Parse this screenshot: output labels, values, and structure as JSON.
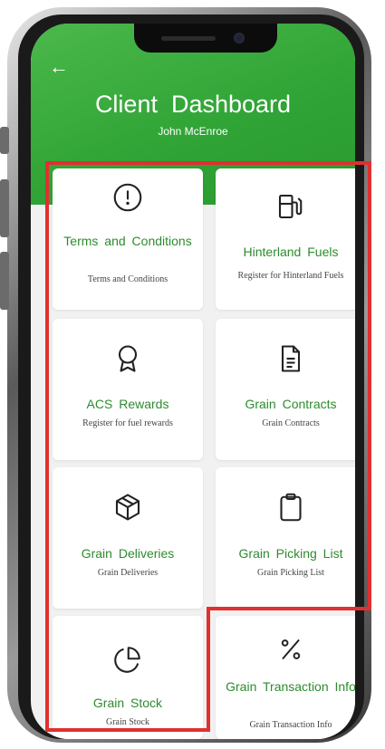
{
  "header": {
    "title": "Client  Dashboard",
    "user_name": "John McEnroe"
  },
  "cards": [
    {
      "label": "Terms  and Conditions",
      "desc": "Terms and Conditions",
      "icon": "alert-circle-icon"
    },
    {
      "label": "Hinterland  Fuels",
      "desc": "Register for Hinterland Fuels",
      "icon": "fuel-pump-icon"
    },
    {
      "label": "ACS  Rewards",
      "desc": "Register for fuel rewards",
      "icon": "award-icon"
    },
    {
      "label": "Grain  Contracts",
      "desc": "Grain Contracts",
      "icon": "document-icon"
    },
    {
      "label": "Grain  Deliveries",
      "desc": "Grain Deliveries",
      "icon": "box-icon"
    },
    {
      "label": "Grain  Picking  List",
      "desc": "Grain Picking List",
      "icon": "clipboard-icon"
    },
    {
      "label": "Grain  Stock",
      "desc": "Grain Stock",
      "icon": "pie-chart-icon"
    },
    {
      "label": "Grain  Transaction Info",
      "desc": "Grain Transaction Info",
      "icon": "percent-icon"
    }
  ],
  "colors": {
    "header_green": "#2fa335",
    "label_green": "#2e8b2e",
    "highlight_red": "#e03030"
  }
}
